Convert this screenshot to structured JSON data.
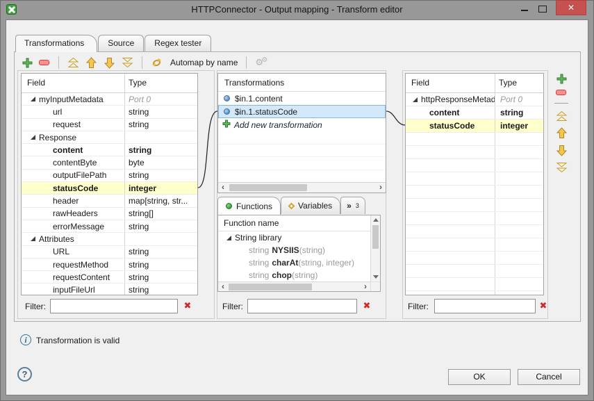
{
  "window": {
    "title": "HTTPConnector - Output mapping - Transform editor"
  },
  "tabs": [
    {
      "label": "Transformations",
      "active": true
    },
    {
      "label": "Source",
      "active": false
    },
    {
      "label": "Regex tester",
      "active": false
    }
  ],
  "toolbar": {
    "automap_label": "Automap by name"
  },
  "left_panel": {
    "columns": [
      "Field",
      "Type"
    ],
    "rows": [
      {
        "field": "myInputMetadata",
        "type": "Port 0",
        "indent": 1,
        "expander": true,
        "port": true
      },
      {
        "field": "url",
        "type": "string",
        "indent": 2
      },
      {
        "field": "request",
        "type": "string",
        "indent": 2
      },
      {
        "field": "Response",
        "type": "",
        "indent": 1,
        "expander": true
      },
      {
        "field": "content",
        "type": "string",
        "indent": 2,
        "bold": true
      },
      {
        "field": "contentByte",
        "type": "byte",
        "indent": 2
      },
      {
        "field": "outputFilePath",
        "type": "string",
        "indent": 2
      },
      {
        "field": "statusCode",
        "type": "integer",
        "indent": 2,
        "bold": true,
        "highlight": true
      },
      {
        "field": "header",
        "type": "map[string, str...",
        "indent": 2
      },
      {
        "field": "rawHeaders",
        "type": "string[]",
        "indent": 2
      },
      {
        "field": "errorMessage",
        "type": "string",
        "indent": 2
      },
      {
        "field": "Attributes",
        "type": "",
        "indent": 1,
        "expander": true
      },
      {
        "field": "URL",
        "type": "string",
        "indent": 2
      },
      {
        "field": "requestMethod",
        "type": "string",
        "indent": 2
      },
      {
        "field": "requestContent",
        "type": "string",
        "indent": 2
      },
      {
        "field": "inputFileUrl",
        "type": "string",
        "indent": 2
      }
    ],
    "filter_label": "Filter:",
    "filter_value": ""
  },
  "transform_panel": {
    "header": "Transformations",
    "items": [
      {
        "label": "$in.1.content",
        "selected": false
      },
      {
        "label": "$in.1.statusCode",
        "selected": true
      }
    ],
    "add_label": "Add new transformation",
    "filter_label": "Filter:",
    "filter_value": ""
  },
  "functions_panel": {
    "tabs": [
      {
        "label": "Functions",
        "active": true
      },
      {
        "label": "Variables",
        "active": false
      }
    ],
    "overflow_indicator": "»",
    "overflow_count": "3",
    "header": "Function name",
    "library": "String library",
    "functions": [
      {
        "ret": "string",
        "name": "NYSIIS",
        "params": "(string)"
      },
      {
        "ret": "string",
        "name": "charAt",
        "params": "(string, integer)"
      },
      {
        "ret": "string",
        "name": "chop",
        "params": "(string)"
      }
    ]
  },
  "right_panel": {
    "columns": [
      "Field",
      "Type"
    ],
    "rows": [
      {
        "field": "httpResponseMetad",
        "type": "Port 0",
        "indent": 1,
        "expander": true,
        "port": true
      },
      {
        "field": "content",
        "type": "string",
        "indent": 2,
        "bold": true
      },
      {
        "field": "statusCode",
        "type": "integer",
        "indent": 2,
        "bold": true,
        "highlight": true
      }
    ],
    "filter_label": "Filter:",
    "filter_value": ""
  },
  "status": {
    "message": "Transformation is valid"
  },
  "footer": {
    "ok_label": "OK",
    "cancel_label": "Cancel",
    "help_glyph": "?"
  },
  "icons": {
    "add": "green plus",
    "remove": "red minus bar",
    "move-top": "gold double chevron up",
    "move-up": "gold arrow up",
    "move-down": "gold arrow down",
    "move-bottom": "gold double chevron down",
    "automap": "gold cycle arrows",
    "settings-gears": "gray gears (disabled)",
    "clear-filter": "red x",
    "info": "blue circled i",
    "help": "circled question mark",
    "tree-expander": "black lower-right triangle",
    "transformation-bullet": "blue sphere",
    "functions-tab": "green dot",
    "variables-tab": "gold diamond",
    "close-window": "white x on red"
  },
  "colors": {
    "highlight_row": "#ffffcc",
    "selection_row": "#d3e9f9",
    "accent_gold": "#f2c14e",
    "accent_green": "#63b763",
    "accent_red": "#cf2b2b",
    "titlebar": "#989898",
    "close_button": "#c75050"
  }
}
